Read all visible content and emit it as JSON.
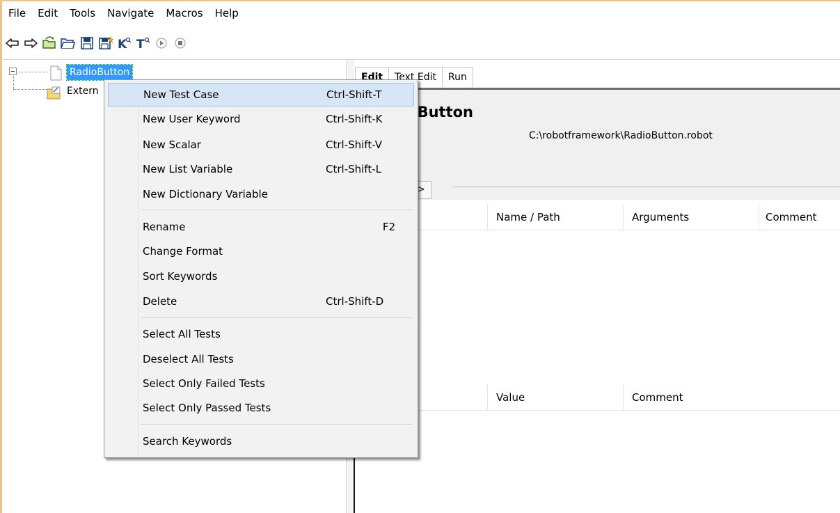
{
  "menubar": [
    "File",
    "Edit",
    "Tools",
    "Navigate",
    "Macros",
    "Help"
  ],
  "toolbar": {
    "icons": [
      "back-arrow-icon",
      "forward-arrow-icon",
      "open-directory-icon",
      "open-folder-icon",
      "save-icon",
      "save-all-icon",
      "keyword-search-icon",
      "test-search-icon",
      "run-icon",
      "stop-icon"
    ],
    "keyword_search_glyph": "K",
    "test_search_glyph": "T"
  },
  "tree": {
    "selected_item": "RadioButton",
    "child_item": "Extern"
  },
  "editor": {
    "tabs": [
      "Edit",
      "Text Edit",
      "Run"
    ],
    "active_tab": "Edit",
    "suite_title": "Button",
    "suite_path": "C:\\robotframework\\RadioButton.robot",
    "settings_button": ">>",
    "imports_columns": [
      "Name / Path",
      "Arguments",
      "Comment"
    ],
    "variables_columns": [
      "Value",
      "Comment"
    ]
  },
  "context_menu": {
    "items": [
      {
        "label": "New Test Case",
        "accel": "Ctrl-Shift-T",
        "highlighted": true
      },
      {
        "label": "New User Keyword",
        "accel": "Ctrl-Shift-K"
      },
      {
        "label": "New Scalar",
        "accel": "Ctrl-Shift-V"
      },
      {
        "label": "New List Variable",
        "accel": "Ctrl-Shift-L"
      },
      {
        "label": "New Dictionary Variable",
        "accel": ""
      },
      {
        "label": "Rename",
        "accel": "F2"
      },
      {
        "label": "Change Format",
        "accel": ""
      },
      {
        "label": "Sort Keywords",
        "accel": ""
      },
      {
        "label": "Delete",
        "accel": "Ctrl-Shift-D"
      },
      {
        "label": "Select All Tests",
        "accel": ""
      },
      {
        "label": "Deselect All Tests",
        "accel": ""
      },
      {
        "label": "Select Only Failed Tests",
        "accel": ""
      },
      {
        "label": "Select Only Passed Tests",
        "accel": ""
      },
      {
        "label": "Search Keywords",
        "accel": ""
      }
    ]
  },
  "colors": {
    "selection": "#3399ff",
    "menu_highlight": "#d7e6f7",
    "window_frame": "#e8c590"
  }
}
